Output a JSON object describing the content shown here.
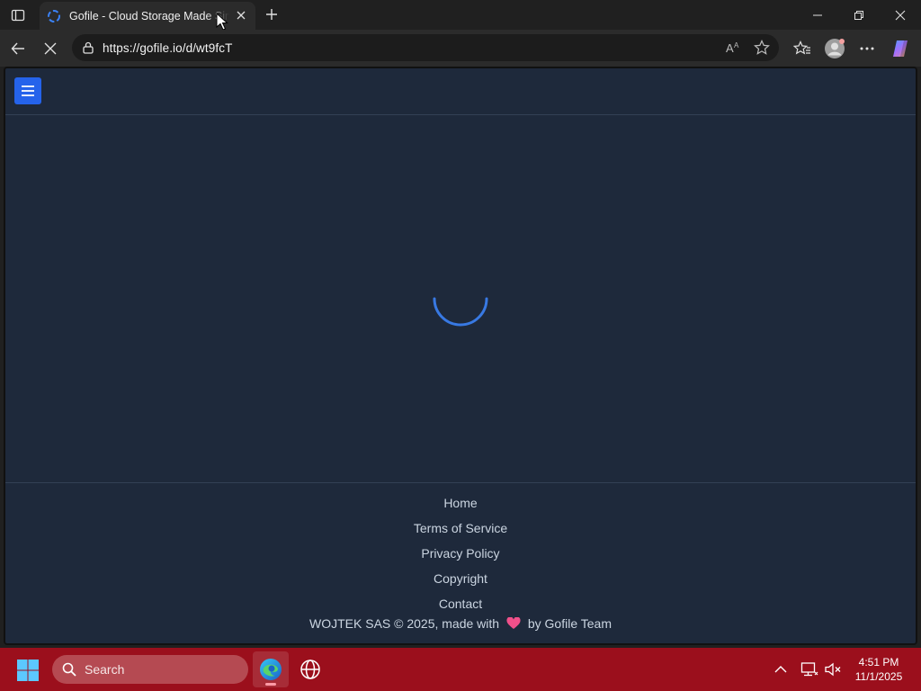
{
  "browser": {
    "tab_title": "Gofile - Cloud Storage Made Simple",
    "url": "https://gofile.io/d/wt9fcT",
    "new_tab": "+"
  },
  "icons": {
    "tab_actions": "tab-actions-icon",
    "favicon": "gofile-favicon-icon",
    "tab_close": "close-icon",
    "new_tab": "plus-icon",
    "minimize": "minimize-icon",
    "restore": "restore-icon",
    "close_window": "close-window-icon",
    "back": "back-arrow-icon",
    "stop": "stop-loading-icon",
    "lock": "site-info-icon",
    "read_aloud": "read-aloud-icon",
    "favorite": "star-icon",
    "favorites": "favorites-icon",
    "profile": "profile-icon",
    "more": "more-icon",
    "copilot": "copilot-icon",
    "hamburger": "hamburger-menu-icon",
    "loader": "loading-spinner-icon",
    "heart": "heart-icon"
  },
  "site": {
    "footer_links": [
      "Home",
      "Terms of Service",
      "Privacy Policy",
      "Copyright",
      "Contact"
    ],
    "copyright_prefix": "WOJTEK SAS © 2025, made with",
    "copyright_suffix": "by Gofile Team",
    "accent_color": "#2563eb",
    "background_color": "#1e293b"
  },
  "taskbar": {
    "search_placeholder": "Search",
    "time": "4:51 PM",
    "date": "11/1/2025",
    "color": "#9b0f1c"
  }
}
